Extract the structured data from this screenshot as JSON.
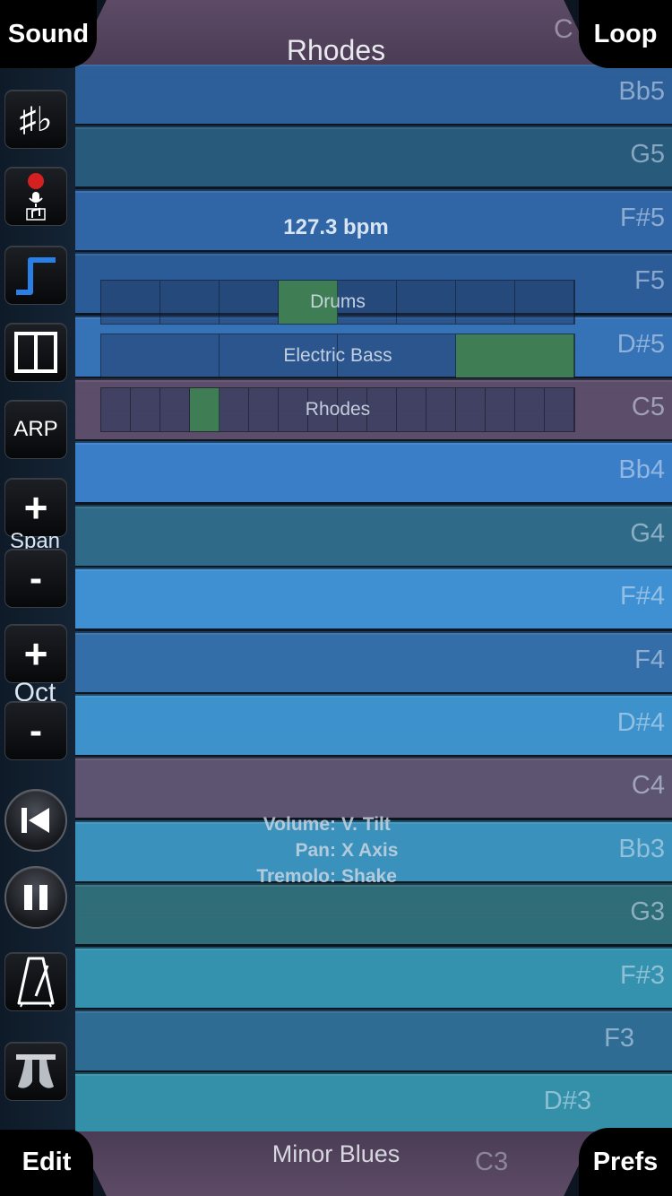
{
  "header": {
    "sound_label": "Sound",
    "loop_label": "Loop",
    "instrument": "Rhodes",
    "ghost_note": "C"
  },
  "footer": {
    "edit_label": "Edit",
    "prefs_label": "Prefs",
    "scale": "Minor Blues",
    "ghost_note": "C3"
  },
  "sidebar": {
    "accidentals_label": "♯♭",
    "arp_label": "ARP",
    "span_label": "Span",
    "oct_label": "Oct",
    "plus_symbol": "+",
    "minus_symbol": "-"
  },
  "tempo": {
    "bpm_text": "127.3 bpm"
  },
  "tracks": [
    {
      "name": "Drums",
      "cells": 8,
      "active": [
        3
      ]
    },
    {
      "name": "Electric Bass",
      "cells": 4,
      "active": [
        3
      ]
    },
    {
      "name": "Rhodes",
      "cells": 16,
      "active": [
        3
      ]
    }
  ],
  "tilt": {
    "volume_key": "Volume:",
    "volume_val": "V. Tilt",
    "pan_key": "Pan:",
    "pan_val": "X Axis",
    "tremolo_key": "Tremolo:",
    "tremolo_val": "Shake"
  },
  "rows": [
    {
      "note": "Bb5",
      "color": "#2d5f99"
    },
    {
      "note": "G5",
      "color": "#285a7c"
    },
    {
      "note": "F#5",
      "color": "#3166a6"
    },
    {
      "note": "F5",
      "color": "#2c5c98"
    },
    {
      "note": "D#5",
      "color": "#3672b6"
    },
    {
      "note": "C5",
      "color": "#5c4d6a"
    },
    {
      "note": "Bb4",
      "color": "#3a7ec8"
    },
    {
      "note": "G4",
      "color": "#2f6b88"
    },
    {
      "note": "F#4",
      "color": "#3f90d2"
    },
    {
      "note": "F4",
      "color": "#346ea8"
    },
    {
      "note": "D#4",
      "color": "#3d92cc"
    },
    {
      "note": "C4",
      "color": "#5c5470"
    },
    {
      "note": "Bb3",
      "color": "#3a92bc"
    },
    {
      "note": "G3",
      "color": "#2f6d78"
    },
    {
      "note": "F#3",
      "color": "#3592ae"
    },
    {
      "note": "F3",
      "color": "#2f6c94"
    },
    {
      "note": "D#3",
      "color": "#3390a8"
    }
  ]
}
